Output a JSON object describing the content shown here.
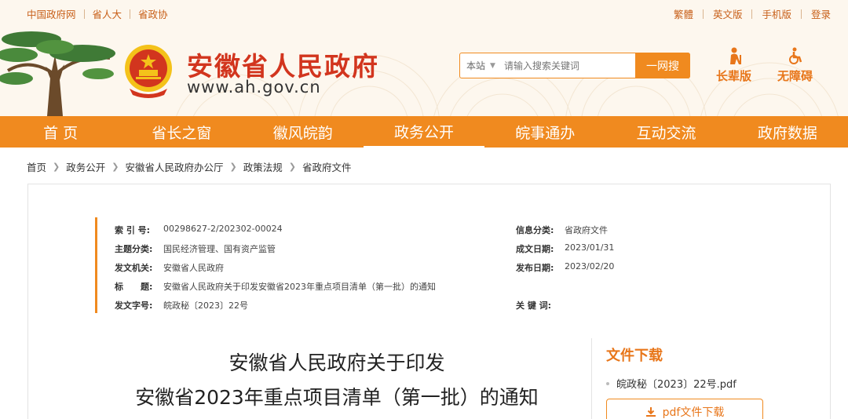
{
  "top_links_left": [
    "中国政府网",
    "省人大",
    "省政协"
  ],
  "top_links_right": [
    "繁體",
    "英文版",
    "手机版",
    "登录"
  ],
  "site": {
    "name": "安徽省人民政府",
    "url": "www.ah.gov.cn"
  },
  "search": {
    "scope": "本站",
    "placeholder": "请输入搜索关键词",
    "button": "一网搜"
  },
  "modes": {
    "elder": "长辈版",
    "accessible": "无障碍"
  },
  "nav": [
    "首 页",
    "省长之窗",
    "徽风皖韵",
    "政务公开",
    "皖事通办",
    "互动交流",
    "政府数据"
  ],
  "nav_active_index": 3,
  "breadcrumb": [
    "首页",
    "政务公开",
    "安徽省人民政府办公厅",
    "政策法规",
    "省政府文件"
  ],
  "meta": {
    "index_label": "索 引 号:",
    "index_value": "00298627-2/202302-00024",
    "category_label": "信息分类:",
    "category_value": "省政府文件",
    "topic_label": "主题分类:",
    "topic_value": "国民经济管理、国有资产监管",
    "created_label": "成文日期:",
    "created_value": "2023/01/31",
    "issuer_label": "发文机关:",
    "issuer_value": "安徽省人民政府",
    "published_label": "发布日期:",
    "published_value": "2023/02/20",
    "title_label": "标　　题:",
    "title_value": "安徽省人民政府关于印发安徽省2023年重点项目清单（第一批）的通知",
    "docno_label": "发文字号:",
    "docno_value": "皖政秘〔2023〕22号",
    "keywords_label": "关 键 词:",
    "keywords_value": ""
  },
  "document": {
    "title_line1": "安徽省人民政府关于印发",
    "title_line2": "安徽省2023年重点项目清单（第一批）的通知"
  },
  "download": {
    "heading": "文件下载",
    "file_name": "皖政秘〔2023〕22号.pdf",
    "button": "pdf文件下载"
  },
  "colors": {
    "accent": "#f08a1f",
    "brand_red": "#d2351e",
    "header_bg": "#fdf7ee"
  }
}
